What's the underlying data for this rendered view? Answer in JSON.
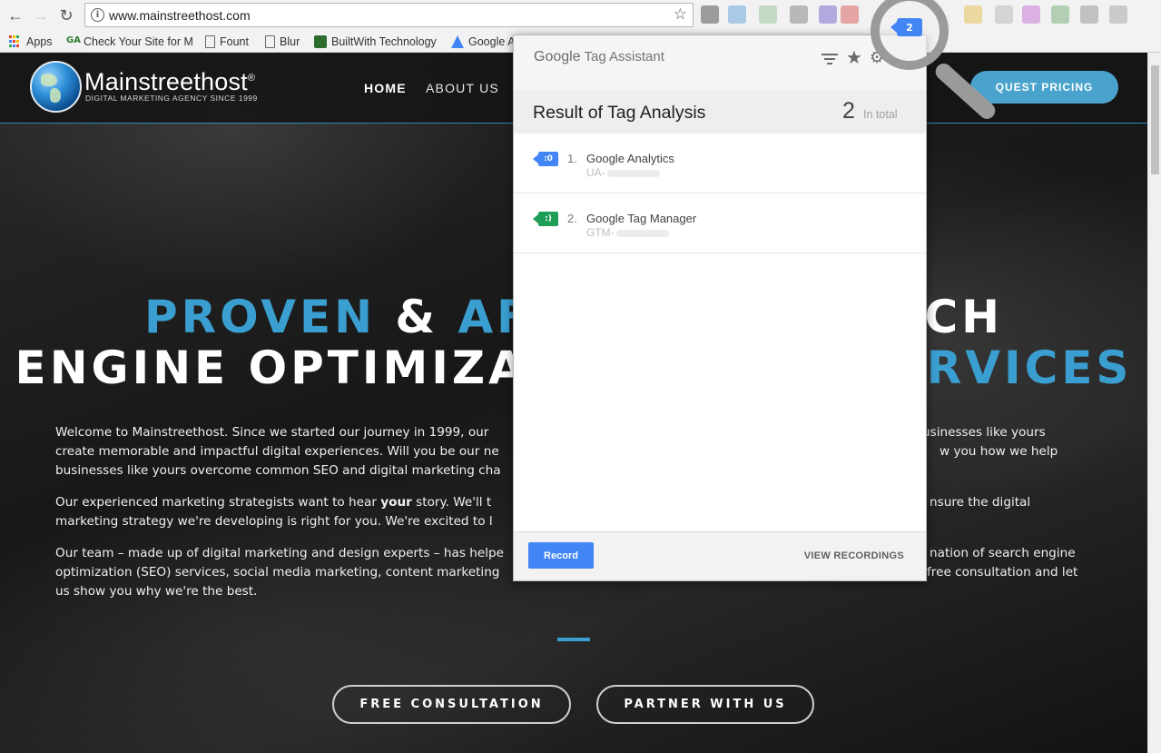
{
  "browser": {
    "url": "www.mainstreethost.com",
    "bookmarks": [
      {
        "label": "Apps"
      },
      {
        "label": "Check Your Site for M"
      },
      {
        "label": "Fount"
      },
      {
        "label": "Blur"
      },
      {
        "label": "BuiltWith Technology"
      },
      {
        "label": "Google A"
      }
    ],
    "extension_badge": "2"
  },
  "site": {
    "brand_name": "Mainstreethost",
    "brand_reg": "®",
    "brand_tagline": "DIGITAL MARKETING AGENCY SINCE 1999",
    "nav": {
      "home": "HOME",
      "about": "ABOUT US"
    },
    "request_pricing": "QUEST PRICING",
    "hero": {
      "line1_a": "PROVEN",
      "line1_b": " & ",
      "line1_c": "AFF",
      "line1_gap": "",
      "line1_d": "CH",
      "line2_a": "ENGINE OPTIMIZA",
      "line2_b": "RVICES"
    },
    "paragraphs": {
      "p1_l1a": "Welcome to Mainstreethost. Since we started our journey in 1999, our",
      "p1_l1b": "usinesses like yours",
      "p1_l2a": "create memorable and impactful digital experiences. Will you be our ne",
      "p1_l2b": "w you how we help",
      "p1_l3a": "businesses like yours overcome common SEO and digital marketing cha",
      "p2_l1a": "Our experienced marketing strategists want to hear ",
      "p2_l1bold": "your",
      "p2_l1c": " story. We'll t",
      "p2_l1d": "nsure the digital",
      "p2_l2a": "marketing strategy we're developing is right for you. We're excited to l",
      "p3_l1a": "Our team – made up of digital marketing and design experts – has helpe",
      "p3_l1b": "nation of search engine",
      "p3_l2a": "optimization (SEO) services, social media marketing, content marketing",
      "p3_l2b": "free consultation and let",
      "p3_l3a": "us show you why we're the best."
    },
    "cta_free": "FREE CONSULTATION",
    "cta_partner": "PARTNER WITH US"
  },
  "tag_assistant": {
    "logo_google": "Google",
    "logo_product": " Tag Assistant",
    "result_title": "Result of Tag Analysis",
    "count": "2",
    "count_label": "In total",
    "tags": [
      {
        "num": "1.",
        "name": "Google Analytics",
        "id_prefix": "UA-",
        "badge": ":0",
        "kind": "ga"
      },
      {
        "num": "2.",
        "name": "Google Tag Manager",
        "id_prefix": "GTM-",
        "badge": ":)",
        "kind": "gtm"
      }
    ],
    "record_label": "Record",
    "view_recordings": "VIEW RECORDINGS"
  },
  "colors": {
    "accent_blue": "#3a9fd0",
    "tag_ga": "#4285f4",
    "tag_gtm": "#1e9e57"
  }
}
